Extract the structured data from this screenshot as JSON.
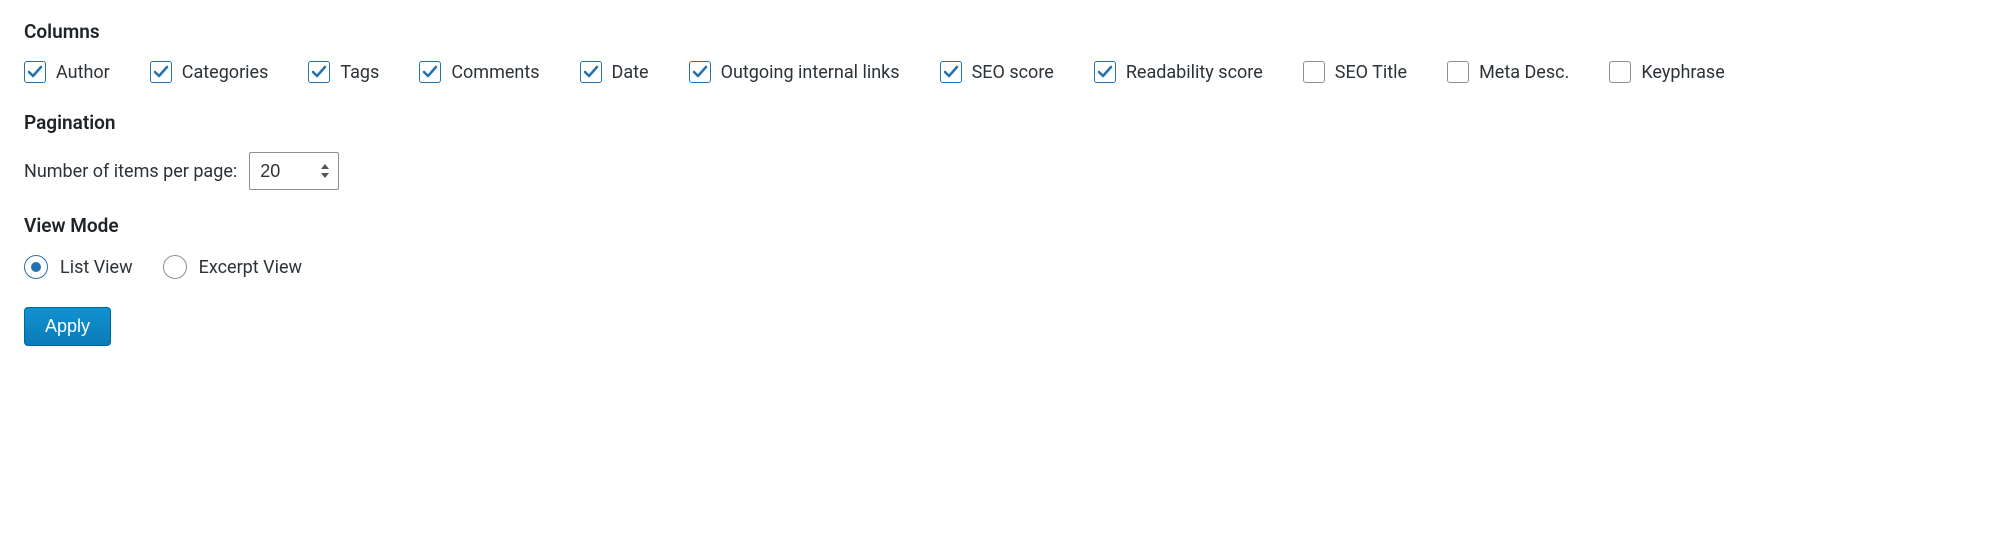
{
  "columns": {
    "heading": "Columns",
    "items": [
      {
        "label": "Author",
        "checked": true
      },
      {
        "label": "Categories",
        "checked": true
      },
      {
        "label": "Tags",
        "checked": true
      },
      {
        "label": "Comments",
        "checked": true
      },
      {
        "label": "Date",
        "checked": true
      },
      {
        "label": "Outgoing internal links",
        "checked": true
      },
      {
        "label": "SEO score",
        "checked": true
      },
      {
        "label": "Readability score",
        "checked": true
      },
      {
        "label": "SEO Title",
        "checked": false
      },
      {
        "label": "Meta Desc.",
        "checked": false
      },
      {
        "label": "Keyphrase",
        "checked": false
      }
    ]
  },
  "pagination": {
    "heading": "Pagination",
    "label": "Number of items per page:",
    "value": "20"
  },
  "viewMode": {
    "heading": "View Mode",
    "options": [
      {
        "label": "List View",
        "selected": true
      },
      {
        "label": "Excerpt View",
        "selected": false
      }
    ]
  },
  "apply": {
    "label": "Apply"
  }
}
